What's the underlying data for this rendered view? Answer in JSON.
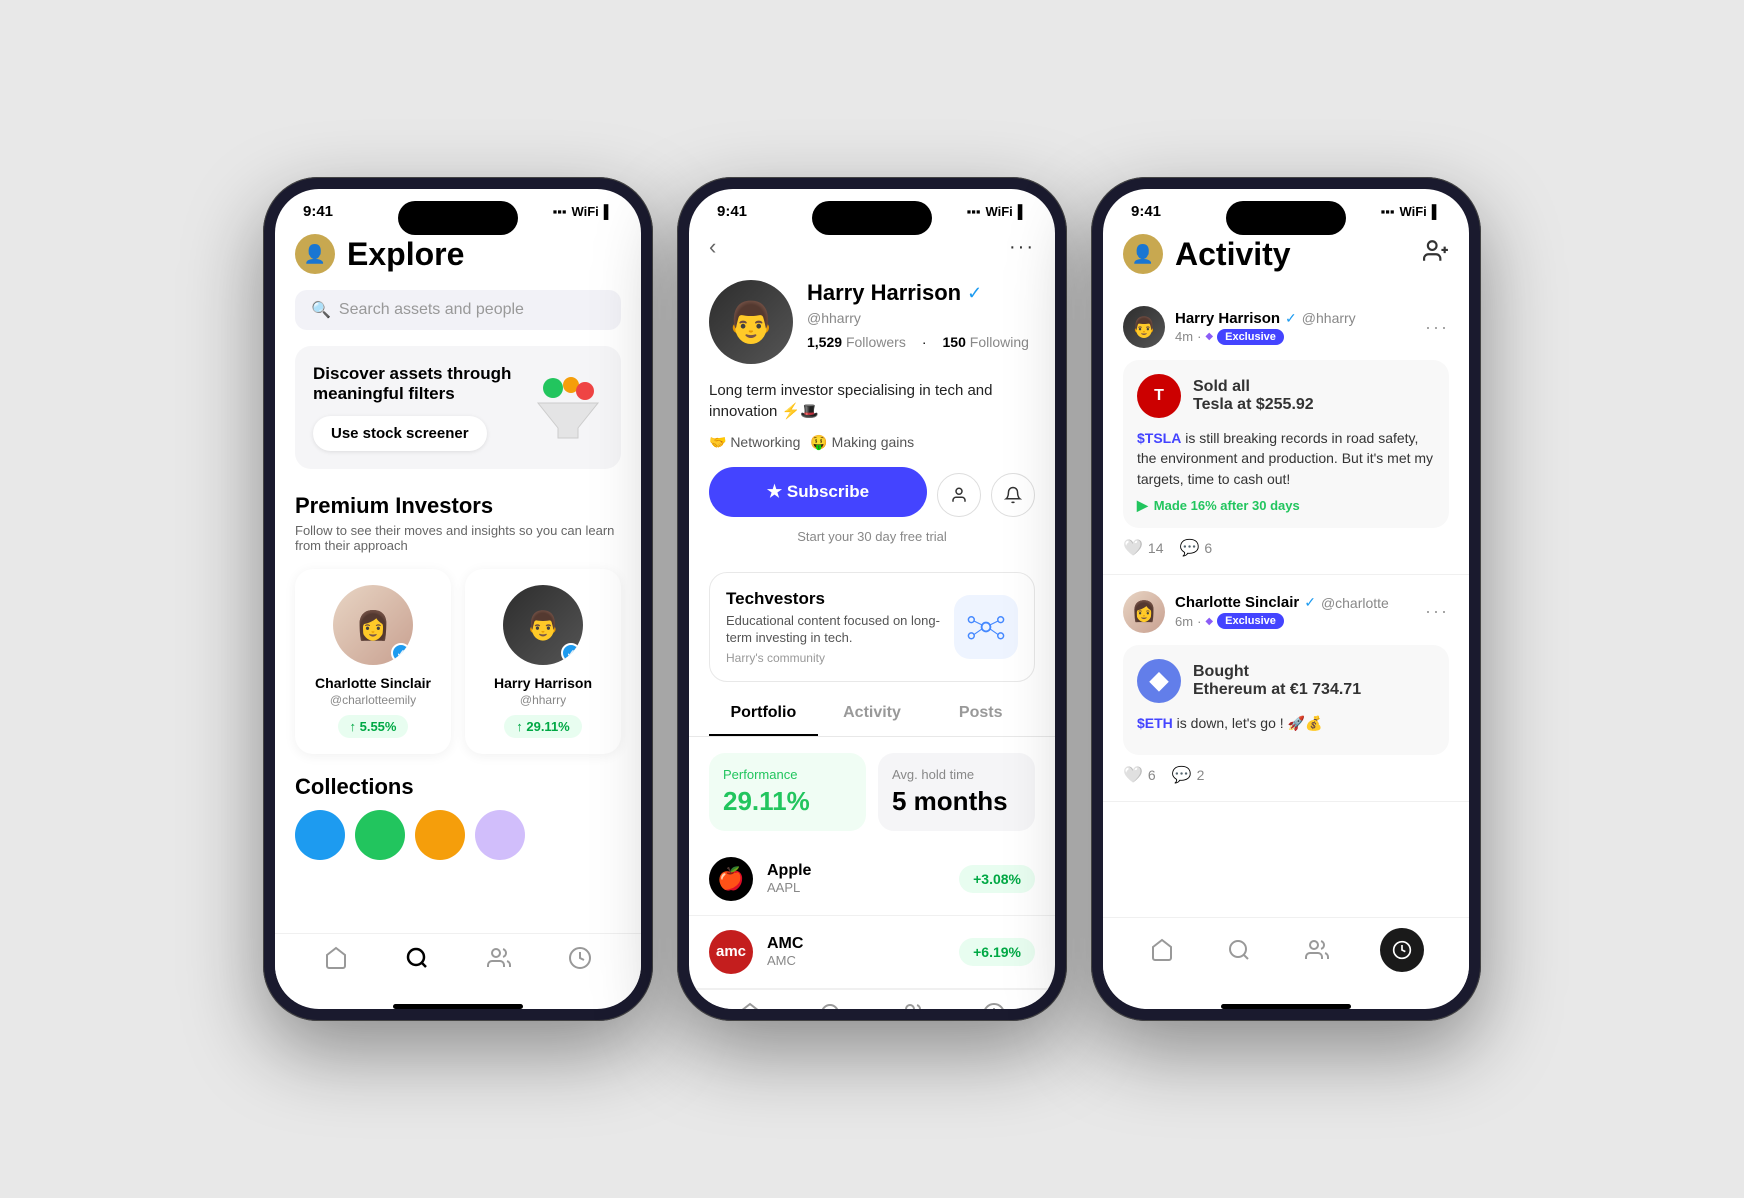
{
  "scene": {
    "background": "#e8e8e8"
  },
  "phone1": {
    "status_time": "9:41",
    "header": {
      "title": "Explore",
      "avatar_emoji": "👤"
    },
    "search": {
      "placeholder": "Search assets and people"
    },
    "screener": {
      "title": "Discover assets through meaningful filters",
      "button_label": "Use stock screener",
      "icon": "🎯"
    },
    "premium_section": {
      "title": "Premium Investors",
      "subtitle": "Follow to see their moves and insights so you can learn from their approach"
    },
    "investors": [
      {
        "name": "Charlotte Sinclair",
        "handle": "@charlotteemily",
        "performance": "↑ 5.55%",
        "avatar_bg": "#e8c4b0"
      },
      {
        "name": "Harry Harrison",
        "handle": "@hharry",
        "performance": "↑ 29.11%",
        "avatar_bg": "#333"
      }
    ],
    "collections_title": "Collections",
    "nav": [
      "feed",
      "search",
      "people",
      "clock"
    ]
  },
  "phone2": {
    "status_time": "9:41",
    "profile": {
      "name": "Harry Harrison",
      "handle": "@hharry",
      "followers": "1,529",
      "following": "150",
      "bio": "Long term investor specialising in tech and innovation ⚡️🎩",
      "tags": [
        "🤝 Networking",
        "🤑 Making gains"
      ],
      "subscribe_label": "★ Subscribe",
      "subscribe_sub": "Start your 30 day free trial"
    },
    "community": {
      "name": "Techvestors",
      "desc": "Educational content focused on long-term investing in tech.",
      "sub": "Harry's community"
    },
    "tabs": [
      "Portfolio",
      "Activity",
      "Posts"
    ],
    "active_tab": "Portfolio",
    "portfolio": {
      "performance_label": "Performance",
      "performance_value": "29.11%",
      "hold_label": "Avg. hold time",
      "hold_value": "5 months"
    },
    "stocks": [
      {
        "name": "Apple",
        "ticker": "AAPL",
        "change": "+3.08%",
        "logo": "🍎"
      },
      {
        "name": "AMC",
        "ticker": "AMC",
        "change": "+6.19%",
        "logo": "amc"
      }
    ],
    "nav": [
      "feed",
      "search",
      "people",
      "clock"
    ]
  },
  "phone3": {
    "status_time": "9:41",
    "header": {
      "title": "Activity"
    },
    "feed": [
      {
        "user": "Harry Harrison",
        "handle": "@hharry",
        "time": "4m",
        "badge": "Exclusive",
        "trade_action": "Sold all",
        "trade_asset": "Tesla at $255.92",
        "logo_type": "tesla",
        "comment": "$TSLA is still breaking records in road safety, the environment and production. But it's met my targets, time to cash out!",
        "ticker": "$TSLA",
        "perf": "Made 16% after 30 days",
        "likes": "14",
        "comments": "6"
      },
      {
        "user": "Charlotte Sinclair",
        "handle": "@charlotte",
        "time": "6m",
        "badge": "Exclusive",
        "trade_action": "Bought",
        "trade_asset": "Ethereum at €1 734.71",
        "logo_type": "eth",
        "comment": "$ETH is down, let's go ! 🚀💰",
        "ticker": "$ETH",
        "perf": null,
        "likes": "6",
        "comments": "2"
      }
    ],
    "nav": [
      "feed",
      "search",
      "people",
      "activity"
    ]
  }
}
